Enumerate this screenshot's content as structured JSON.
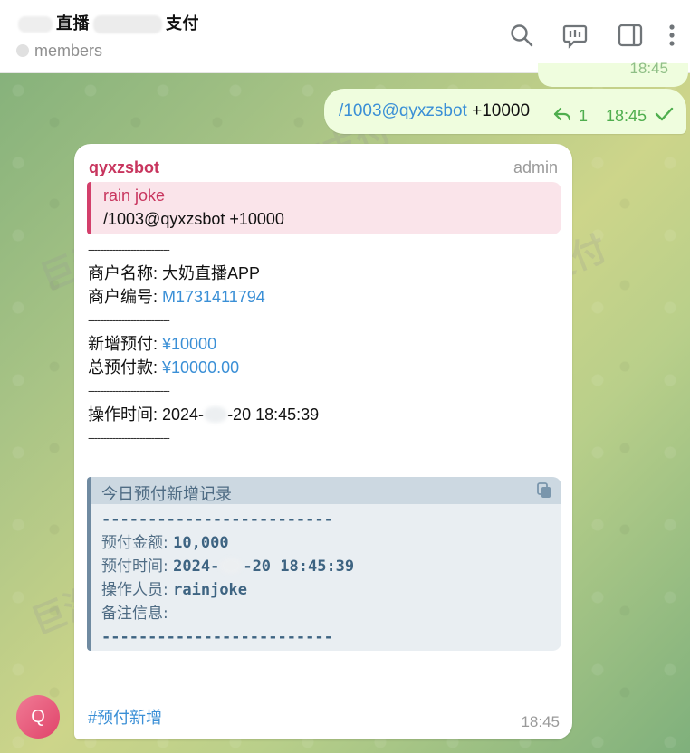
{
  "header": {
    "title_part1": "直播",
    "title_part2": "支付",
    "subtitle": "members"
  },
  "icons": {
    "search": "search-icon",
    "poll": "poll-icon",
    "sidebar": "sidebar-toggle-icon",
    "more": "more-vertical-icon"
  },
  "outgoing": {
    "command": "/1003@qyxzsbot",
    "amount": "+10000",
    "reply_count": "1",
    "time": "18:45",
    "prev_time": "18:45"
  },
  "message": {
    "sender": "qyxzsbot",
    "role": "admin",
    "reply_name": "rain joke",
    "reply_text": "/1003@qyxzsbot +10000",
    "sep": "---------------------------",
    "merchant_name_label": "商户名称: ",
    "merchant_name": "大奶直播APP",
    "merchant_id_label": "商户编号: ",
    "merchant_id": "M1731411794",
    "new_prepay_label": "新增预付: ",
    "new_prepay": "¥10000",
    "total_prepay_label": "总预付款: ",
    "total_prepay": "¥10000.00",
    "op_time_label": "操作时间: ",
    "op_time_a": "2024-",
    "op_time_b": "-20 18:45:39",
    "hashtag": "#预付新增",
    "time": "18:45"
  },
  "code_block": {
    "title": "今日预付新增记录",
    "sep": "-------------------------",
    "amount_label": "预付金额: ",
    "amount": "10,000",
    "time_label": "预付时间: ",
    "time_a": "2024-",
    "time_b": "-20 18:45:39",
    "operator_label": "操作人员: ",
    "operator": "rainjoke",
    "note_label": "备注信息: "
  },
  "avatar": {
    "initial": "Q"
  },
  "watermark": {
    "text": "巨海支付"
  },
  "colors": {
    "sender": "#c8355e",
    "link": "#3a8fd6",
    "check": "#4fae4e"
  }
}
